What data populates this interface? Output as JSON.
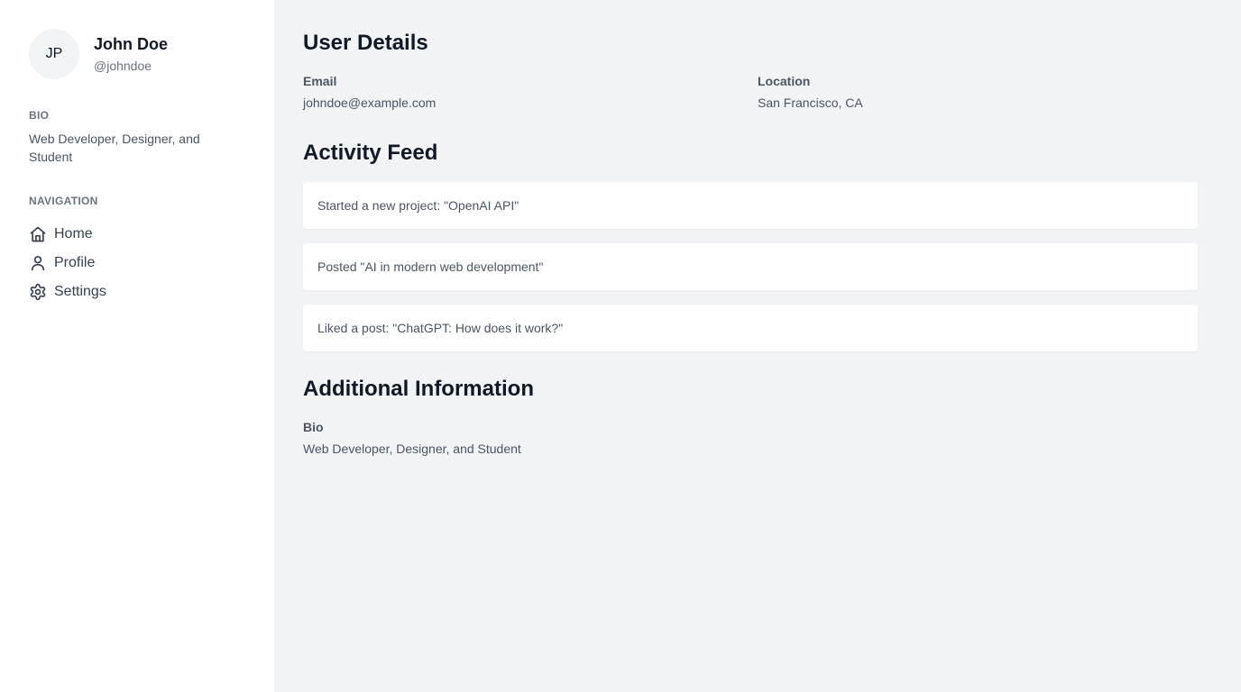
{
  "sidebar": {
    "avatar_initials": "JP",
    "name": "John Doe",
    "handle": "@johndoe",
    "bio_label": "BIO",
    "bio_text": "Web Developer, Designer, and Student",
    "nav_label": "NAVIGATION",
    "nav_items": [
      {
        "label": "Home",
        "icon": "home-icon"
      },
      {
        "label": "Profile",
        "icon": "user-icon"
      },
      {
        "label": "Settings",
        "icon": "gear-icon"
      }
    ]
  },
  "main": {
    "user_details_title": "User Details",
    "email_label": "Email",
    "email_value": "johndoe@example.com",
    "location_label": "Location",
    "location_value": "San Francisco, CA",
    "activity_title": "Activity Feed",
    "activity": [
      "Started a new project: \"OpenAI API\"",
      "Posted \"AI in modern web development\"",
      "Liked a post: \"ChatGPT: How does it work?\""
    ],
    "additional_title": "Additional Information",
    "bio_label": "Bio",
    "bio_value": "Web Developer, Designer, and Student"
  },
  "colors": {
    "sidebar_bg": "#ffffff",
    "main_bg": "#f2f3f5",
    "text_primary": "#111827",
    "text_secondary": "#4b5563",
    "text_muted": "#6b7280"
  }
}
